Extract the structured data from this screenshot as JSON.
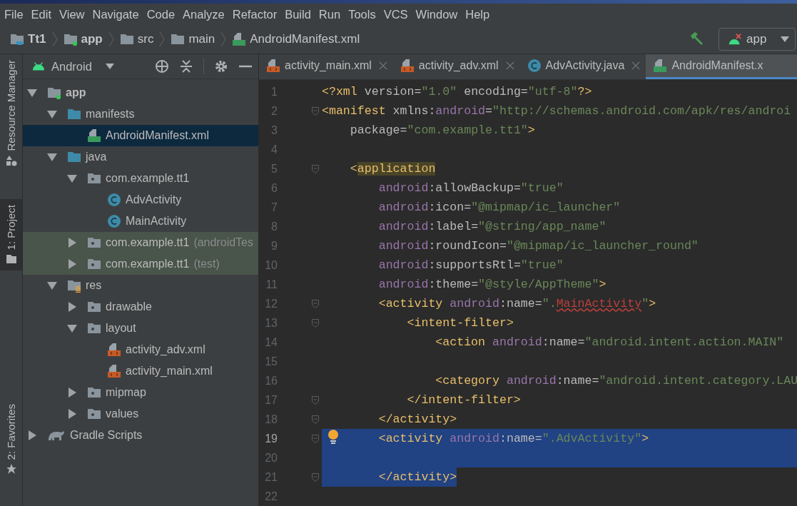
{
  "menu": [
    "File",
    "Edit",
    "View",
    "Navigate",
    "Code",
    "Analyze",
    "Refactor",
    "Build",
    "Run",
    "Tools",
    "VCS",
    "Window",
    "Help"
  ],
  "breadcrumbs": [
    {
      "label": "Tt1",
      "kind": "project"
    },
    {
      "label": "app",
      "kind": "module"
    },
    {
      "label": "src",
      "kind": "folder"
    },
    {
      "label": "main",
      "kind": "folder"
    },
    {
      "label": "AndroidManifest.xml",
      "kind": "manifest"
    }
  ],
  "run_config": {
    "label": "app"
  },
  "side_tabs": [
    {
      "label": "Resource Manager",
      "kind": "resource",
      "selected": false
    },
    {
      "label": "1: Project",
      "kind": "folder",
      "selected": true
    },
    {
      "label": "2: Favorites",
      "kind": "star",
      "selected": false
    }
  ],
  "project_panel": {
    "view": "Android"
  },
  "tree": [
    {
      "label": "app",
      "kind": "module",
      "expanded": true,
      "selected": false,
      "tinted": false,
      "children": [
        {
          "label": "manifests",
          "kind": "source",
          "expanded": true,
          "selected": false,
          "tinted": false,
          "children": [
            {
              "label": "AndroidManifest.xml",
              "kind": "manifest",
              "selected": true,
              "tinted": false
            }
          ]
        },
        {
          "label": "java",
          "kind": "source",
          "expanded": true,
          "selected": false,
          "tinted": false,
          "children": [
            {
              "label": "com.example.tt1",
              "kind": "package",
              "expanded": true,
              "selected": false,
              "tinted": false,
              "children": [
                {
                  "label": "AdvActivity",
                  "kind": "class",
                  "selected": false,
                  "tinted": false
                },
                {
                  "label": "MainActivity",
                  "kind": "class",
                  "selected": false,
                  "tinted": false
                }
              ]
            },
            {
              "label": "com.example.tt1",
              "suffix": "(androidTes",
              "kind": "package",
              "expanded": false,
              "selected": false,
              "tinted": true
            },
            {
              "label": "com.example.tt1",
              "suffix": "(test)",
              "kind": "package",
              "expanded": false,
              "selected": false,
              "tinted": true
            }
          ]
        },
        {
          "label": "res",
          "kind": "res",
          "expanded": true,
          "selected": false,
          "tinted": false,
          "children": [
            {
              "label": "drawable",
              "kind": "package",
              "expanded": false,
              "selected": false,
              "tinted": false
            },
            {
              "label": "layout",
              "kind": "package",
              "expanded": true,
              "selected": false,
              "tinted": false,
              "children": [
                {
                  "label": "activity_adv.xml",
                  "kind": "layout",
                  "selected": false,
                  "tinted": false
                },
                {
                  "label": "activity_main.xml",
                  "kind": "layout",
                  "selected": false,
                  "tinted": false
                }
              ]
            },
            {
              "label": "mipmap",
              "kind": "package",
              "expanded": false,
              "selected": false,
              "tinted": false
            },
            {
              "label": "values",
              "kind": "package",
              "expanded": false,
              "selected": false,
              "tinted": false
            }
          ]
        }
      ]
    },
    {
      "label": "Gradle Scripts",
      "kind": "gradle",
      "expanded": false,
      "selected": false,
      "tinted": false
    }
  ],
  "tabs": [
    {
      "label": "activity_main.xml",
      "kind": "layout",
      "selected": false,
      "close": true
    },
    {
      "label": "activity_adv.xml",
      "kind": "layout",
      "selected": false,
      "close": true
    },
    {
      "label": "AdvActivity.java",
      "kind": "class",
      "selected": false,
      "close": true
    },
    {
      "label": "AndroidManifest.x",
      "kind": "manifest",
      "selected": true,
      "close": false
    }
  ],
  "code": [
    {
      "number": "1",
      "fold": false,
      "bulb": false,
      "selected": false,
      "tokens": [
        {
          "kind": "tag",
          "text": "<?xml "
        },
        {
          "kind": "attr",
          "text": "version="
        },
        {
          "kind": "str",
          "text": "\"1.0\" "
        },
        {
          "kind": "attr",
          "text": "encoding="
        },
        {
          "kind": "str",
          "text": "\"utf-8\""
        },
        {
          "kind": "tag",
          "text": "?>"
        }
      ]
    },
    {
      "number": "2",
      "fold": true,
      "bulb": false,
      "selected": false,
      "tokens": [
        {
          "kind": "tag",
          "text": "<manifest "
        },
        {
          "kind": "attr",
          "text": "xmlns:"
        },
        {
          "kind": "ns",
          "text": "android"
        },
        {
          "kind": "attr",
          "text": "="
        },
        {
          "kind": "str",
          "text": "\"http://schemas.android.com/apk/res/androi"
        }
      ]
    },
    {
      "number": "3",
      "fold": false,
      "bulb": false,
      "selected": false,
      "tokens": [
        {
          "kind": "attr",
          "text": "    package="
        },
        {
          "kind": "str",
          "text": "\"com.example.tt1\""
        },
        {
          "kind": "tag",
          "text": ">"
        }
      ]
    },
    {
      "number": "4",
      "fold": false,
      "bulb": false,
      "selected": false
    },
    {
      "number": "5",
      "fold": true,
      "bulb": false,
      "selected": false,
      "tokens": [
        {
          "kind": "tag",
          "text": "    <"
        },
        {
          "kind": "match",
          "text": "application"
        }
      ]
    },
    {
      "number": "6",
      "fold": false,
      "bulb": false,
      "selected": false,
      "tokens": [
        {
          "kind": "ns",
          "text": "        android"
        },
        {
          "kind": "attr",
          "text": ":allowBackup="
        },
        {
          "kind": "str",
          "text": "\"true\""
        }
      ]
    },
    {
      "number": "7",
      "fold": false,
      "bulb": false,
      "selected": false,
      "tokens": [
        {
          "kind": "ns",
          "text": "        android"
        },
        {
          "kind": "attr",
          "text": ":icon="
        },
        {
          "kind": "str",
          "text": "\"@mipmap/ic_launcher\""
        }
      ]
    },
    {
      "number": "8",
      "fold": false,
      "bulb": false,
      "selected": false,
      "tokens": [
        {
          "kind": "ns",
          "text": "        android"
        },
        {
          "kind": "attr",
          "text": ":label="
        },
        {
          "kind": "str",
          "text": "\"@string/app_name\""
        }
      ]
    },
    {
      "number": "9",
      "fold": false,
      "bulb": false,
      "selected": false,
      "tokens": [
        {
          "kind": "ns",
          "text": "        android"
        },
        {
          "kind": "attr",
          "text": ":roundIcon="
        },
        {
          "kind": "str",
          "text": "\"@mipmap/ic_launcher_round\""
        }
      ]
    },
    {
      "number": "10",
      "fold": false,
      "bulb": false,
      "selected": false,
      "tokens": [
        {
          "kind": "ns",
          "text": "        android"
        },
        {
          "kind": "attr",
          "text": ":supportsRtl="
        },
        {
          "kind": "str",
          "text": "\"true\""
        }
      ]
    },
    {
      "number": "11",
      "fold": false,
      "bulb": false,
      "selected": false,
      "tokens": [
        {
          "kind": "ns",
          "text": "        android"
        },
        {
          "kind": "attr",
          "text": ":theme="
        },
        {
          "kind": "str",
          "text": "\"@style/AppTheme\""
        },
        {
          "kind": "tag",
          "text": ">"
        }
      ]
    },
    {
      "number": "12",
      "fold": true,
      "bulb": false,
      "selected": false,
      "tokens": [
        {
          "kind": "tag",
          "text": "        <activity "
        },
        {
          "kind": "ns",
          "text": "android"
        },
        {
          "kind": "attr",
          "text": ":name="
        },
        {
          "kind": "str",
          "text": "\"."
        },
        {
          "kind": "error",
          "text": "MainActivity"
        },
        {
          "kind": "str",
          "text": "\""
        },
        {
          "kind": "tag",
          "text": ">"
        }
      ]
    },
    {
      "number": "13",
      "fold": true,
      "bulb": false,
      "selected": false,
      "tokens": [
        {
          "kind": "tag",
          "text": "            <intent-filter>"
        }
      ]
    },
    {
      "number": "14",
      "fold": false,
      "bulb": false,
      "selected": false,
      "tokens": [
        {
          "kind": "tag",
          "text": "                <action "
        },
        {
          "kind": "ns",
          "text": "android"
        },
        {
          "kind": "attr",
          "text": ":name="
        },
        {
          "kind": "str",
          "text": "\"android.intent.action.MAIN\""
        }
      ]
    },
    {
      "number": "15",
      "fold": false,
      "bulb": false,
      "selected": false
    },
    {
      "number": "16",
      "fold": false,
      "bulb": false,
      "selected": false,
      "tokens": [
        {
          "kind": "tag",
          "text": "                <category "
        },
        {
          "kind": "ns",
          "text": "android"
        },
        {
          "kind": "attr",
          "text": ":name="
        },
        {
          "kind": "str",
          "text": "\"android.intent.category.LAU"
        }
      ]
    },
    {
      "number": "17",
      "fold": true,
      "bulb": false,
      "selected": false,
      "tokens": [
        {
          "kind": "tag",
          "text": "            </intent-filter>"
        }
      ]
    },
    {
      "number": "18",
      "fold": true,
      "bulb": false,
      "selected": false,
      "tokens": [
        {
          "kind": "tag",
          "text": "        </activity>"
        }
      ]
    },
    {
      "number": "19",
      "fold": true,
      "bulb": true,
      "selected": true,
      "tokens": [
        {
          "kind": "tag",
          "text": "        <activity "
        },
        {
          "kind": "ns",
          "text": "android"
        },
        {
          "kind": "attr",
          "text": ":name="
        },
        {
          "kind": "str",
          "text": "\".AdvActivity\""
        },
        {
          "kind": "tag",
          "text": ">"
        }
      ]
    },
    {
      "number": "20",
      "fold": false,
      "bulb": false,
      "selected": true
    },
    {
      "number": "21",
      "fold": true,
      "bulb": false,
      "selected": true,
      "tokens": [
        {
          "kind": "tag",
          "text": "        </activity>"
        }
      ]
    },
    {
      "number": "22",
      "fold": false,
      "bulb": false,
      "selected": false
    }
  ]
}
